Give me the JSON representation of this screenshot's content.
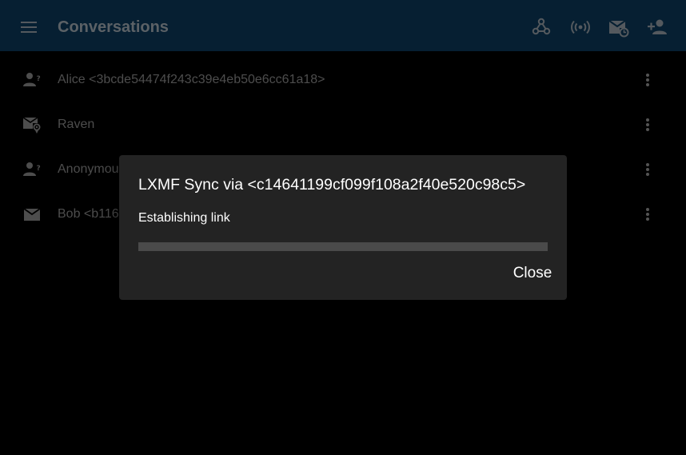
{
  "app": {
    "title": "Conversations",
    "colors": {
      "topbar": "#0b3a5b",
      "title": "#a7b1bb",
      "icon": "#9aa3ab",
      "row_text": "#8c8c8c"
    }
  },
  "toolbar": {
    "menu_icon": "hamburger-menu-icon",
    "icons": [
      "webhook-network-icon",
      "radio-broadcast-icon",
      "mail-sync-icon",
      "add-person-icon"
    ]
  },
  "conversations": [
    {
      "label": "Alice <3bcde54474f243c39e4eb50e6cc61a18>",
      "icon": "person-unknown-icon"
    },
    {
      "label": "Raven",
      "icon": "mail-location-icon"
    },
    {
      "label": "Anonymou",
      "icon": "person-unknown-icon"
    },
    {
      "label": "Bob <b116",
      "icon": "mail-icon"
    }
  ],
  "dialog": {
    "title": "LXMF Sync via <c14641199cf099f108a2f40e520c98c5>",
    "status": "Establishing link",
    "progress": 0,
    "close_label": "Close"
  }
}
